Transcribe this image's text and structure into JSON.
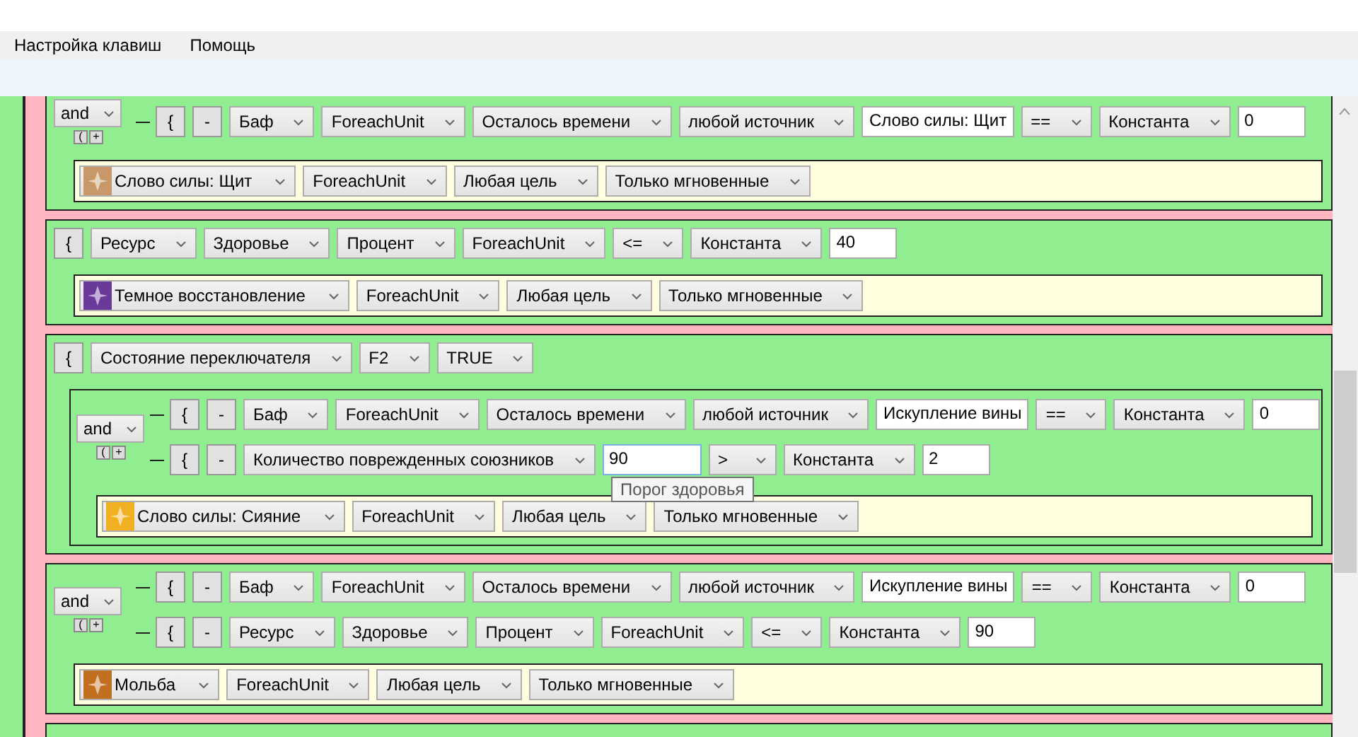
{
  "menu": [
    {
      "label": "Настройка клавиш"
    },
    {
      "label": "Помощь"
    }
  ],
  "blocks": [
    {
      "items": [
        {
          "kind": "group",
          "operator": "and",
          "small_buttons": [
            "(",
            "+"
          ],
          "rows": [
            {
              "controls": [
                {
                  "kind": "brace",
                  "label": "{"
                },
                {
                  "kind": "remove",
                  "label": "-"
                },
                {
                  "kind": "dropdown",
                  "label": "Баф"
                },
                {
                  "kind": "dropdown",
                  "label": "ForeachUnit"
                },
                {
                  "kind": "dropdown",
                  "label": "Осталось времени"
                },
                {
                  "kind": "dropdown",
                  "label": "любой источник"
                },
                {
                  "kind": "field",
                  "value": "Слово силы: Щит",
                  "focused": false
                },
                {
                  "kind": "dropdown",
                  "label": "=="
                },
                {
                  "kind": "dropdown",
                  "label": "Константа"
                },
                {
                  "kind": "field",
                  "value": "0",
                  "focused": false
                }
              ]
            }
          ]
        },
        {
          "kind": "action",
          "controls": [
            {
              "kind": "spell",
              "label": "Слово силы: Щит",
              "color": "#c89868"
            },
            {
              "kind": "dropdown",
              "label": "ForeachUnit"
            },
            {
              "kind": "dropdown",
              "label": "Любая цель"
            },
            {
              "kind": "dropdown",
              "label": "Только мгновенные"
            }
          ]
        }
      ]
    },
    {
      "items": [
        {
          "kind": "row",
          "controls": [
            {
              "kind": "brace",
              "label": "{"
            },
            {
              "kind": "dropdown",
              "label": "Ресурс"
            },
            {
              "kind": "dropdown",
              "label": "Здоровье"
            },
            {
              "kind": "dropdown",
              "label": "Процент"
            },
            {
              "kind": "dropdown",
              "label": "ForeachUnit"
            },
            {
              "kind": "dropdown",
              "label": "<="
            },
            {
              "kind": "dropdown",
              "label": "Константа"
            },
            {
              "kind": "field",
              "value": "40",
              "focused": false
            }
          ]
        },
        {
          "kind": "action",
          "controls": [
            {
              "kind": "spell",
              "label": "Темное восстановление",
              "color": "#6a3a9a"
            },
            {
              "kind": "dropdown",
              "label": "ForeachUnit"
            },
            {
              "kind": "dropdown",
              "label": "Любая цель"
            },
            {
              "kind": "dropdown",
              "label": "Только мгновенные"
            }
          ]
        }
      ]
    },
    {
      "items": [
        {
          "kind": "row",
          "controls": [
            {
              "kind": "brace",
              "label": "{"
            },
            {
              "kind": "dropdown",
              "label": "Состояние переключателя"
            },
            {
              "kind": "dropdown",
              "label": "F2"
            },
            {
              "kind": "dropdown",
              "label": "TRUE"
            }
          ]
        },
        {
          "kind": "block",
          "items": [
            {
              "kind": "group",
              "operator": "and",
              "small_buttons": [
                "(",
                "+"
              ],
              "rows": [
                {
                  "controls": [
                    {
                      "kind": "brace",
                      "label": "{"
                    },
                    {
                      "kind": "remove",
                      "label": "-"
                    },
                    {
                      "kind": "dropdown",
                      "label": "Баф"
                    },
                    {
                      "kind": "dropdown",
                      "label": "ForeachUnit"
                    },
                    {
                      "kind": "dropdown",
                      "label": "Осталось времени"
                    },
                    {
                      "kind": "dropdown",
                      "label": "любой источник"
                    },
                    {
                      "kind": "field",
                      "value": "Искупление вины",
                      "focused": false
                    },
                    {
                      "kind": "dropdown",
                      "label": "=="
                    },
                    {
                      "kind": "dropdown",
                      "label": "Константа"
                    },
                    {
                      "kind": "field",
                      "value": "0",
                      "focused": false
                    }
                  ]
                },
                {
                  "controls": [
                    {
                      "kind": "brace",
                      "label": "{"
                    },
                    {
                      "kind": "remove",
                      "label": "-"
                    },
                    {
                      "kind": "dropdown",
                      "label": "Количество поврежденных союзников"
                    },
                    {
                      "kind": "field",
                      "value": "90",
                      "focused": true,
                      "tooltip": "Порог здоровья"
                    },
                    {
                      "kind": "dropdown",
                      "label": ">"
                    },
                    {
                      "kind": "dropdown",
                      "label": "Константа"
                    },
                    {
                      "kind": "field",
                      "value": "2",
                      "focused": false
                    }
                  ]
                }
              ]
            },
            {
              "kind": "action",
              "controls": [
                {
                  "kind": "spell",
                  "label": "Слово силы: Сияние",
                  "color": "#f0b020"
                },
                {
                  "kind": "dropdown",
                  "label": "ForeachUnit"
                },
                {
                  "kind": "dropdown",
                  "label": "Любая цель"
                },
                {
                  "kind": "dropdown",
                  "label": "Только мгновенные"
                }
              ]
            }
          ]
        }
      ]
    },
    {
      "items": [
        {
          "kind": "group",
          "operator": "and",
          "small_buttons": [
            "(",
            "+"
          ],
          "rows": [
            {
              "controls": [
                {
                  "kind": "brace",
                  "label": "{"
                },
                {
                  "kind": "remove",
                  "label": "-"
                },
                {
                  "kind": "dropdown",
                  "label": "Баф"
                },
                {
                  "kind": "dropdown",
                  "label": "ForeachUnit"
                },
                {
                  "kind": "dropdown",
                  "label": "Осталось времени"
                },
                {
                  "kind": "dropdown",
                  "label": "любой источник"
                },
                {
                  "kind": "field",
                  "value": "Искупление вины",
                  "focused": false
                },
                {
                  "kind": "dropdown",
                  "label": "=="
                },
                {
                  "kind": "dropdown",
                  "label": "Константа"
                },
                {
                  "kind": "field",
                  "value": "0",
                  "focused": false
                }
              ]
            },
            {
              "controls": [
                {
                  "kind": "brace",
                  "label": "{"
                },
                {
                  "kind": "remove",
                  "label": "-"
                },
                {
                  "kind": "dropdown",
                  "label": "Ресурс"
                },
                {
                  "kind": "dropdown",
                  "label": "Здоровье"
                },
                {
                  "kind": "dropdown",
                  "label": "Процент"
                },
                {
                  "kind": "dropdown",
                  "label": "ForeachUnit"
                },
                {
                  "kind": "dropdown",
                  "label": "<="
                },
                {
                  "kind": "dropdown",
                  "label": "Константа"
                },
                {
                  "kind": "field",
                  "value": "90",
                  "focused": false
                }
              ]
            }
          ]
        },
        {
          "kind": "action",
          "controls": [
            {
              "kind": "spell",
              "label": "Мольба",
              "color": "#c07020"
            },
            {
              "kind": "dropdown",
              "label": "ForeachUnit"
            },
            {
              "kind": "dropdown",
              "label": "Любая цель"
            },
            {
              "kind": "dropdown",
              "label": "Только мгновенные"
            }
          ]
        }
      ]
    }
  ]
}
